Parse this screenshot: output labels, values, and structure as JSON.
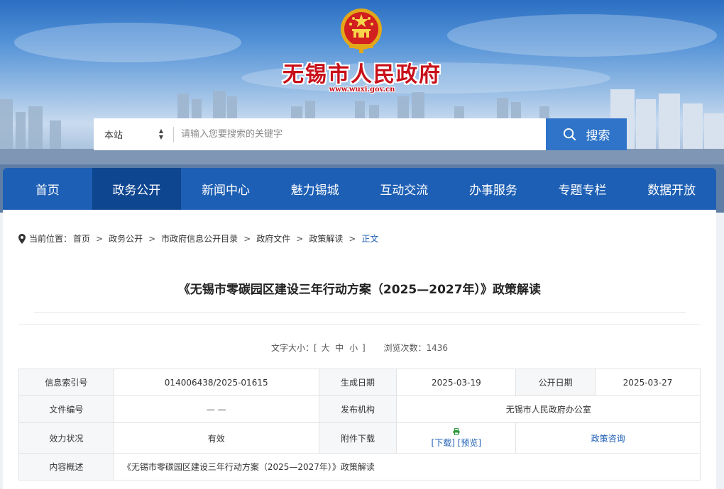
{
  "site": {
    "title": "无锡市人民政府",
    "url": "www.wuxi.gov.cn"
  },
  "search": {
    "scope": "本站",
    "placeholder": "请输入您要搜索的关键字",
    "button_label": "搜索"
  },
  "nav": {
    "items": [
      {
        "label": "首页"
      },
      {
        "label": "政务公开",
        "active": true
      },
      {
        "label": "新闻中心"
      },
      {
        "label": "魅力锡城"
      },
      {
        "label": "互动交流"
      },
      {
        "label": "办事服务"
      },
      {
        "label": "专题专栏"
      },
      {
        "label": "数据开放"
      }
    ]
  },
  "breadcrumb": {
    "prefix": "当前位置：",
    "items": [
      "首页",
      "政务公开",
      "市政府信息公开目录",
      "政府文件",
      "政策解读"
    ],
    "current": "正文"
  },
  "document": {
    "title": "《无锡市零碳园区建设三年行动方案（2025—2027年）》政策解读",
    "font_size_label": "文字大小：[",
    "font_sizes": [
      "大",
      "中",
      "小"
    ],
    "font_size_close": "]",
    "views_label": "浏览次数：",
    "views": "1436"
  },
  "info_table": {
    "index_label": "信息索引号",
    "index_value": "014006438/2025-01615",
    "created_label": "生成日期",
    "created_value": "2025-03-19",
    "published_label": "公开日期",
    "published_value": "2025-03-27",
    "docno_label": "文件编号",
    "docno_value": "— —",
    "issuer_label": "发布机构",
    "issuer_value": "无锡市人民政府办公室",
    "validity_label": "效力状况",
    "validity_value": "有效",
    "attachment_label": "附件下载",
    "download_label": "[下载]",
    "preview_label": "[预览]",
    "consult_label": "政策咨询",
    "summary_label": "内容概述",
    "summary_value": "《无锡市零碳园区建设三年行动方案（2025—2027年）》政策解读"
  },
  "colors": {
    "nav": "#1d5fb4",
    "nav_active": "#0f4690",
    "search_button": "#2f74c8",
    "title_red": "#c8101a",
    "link": "#1d5fb4"
  }
}
